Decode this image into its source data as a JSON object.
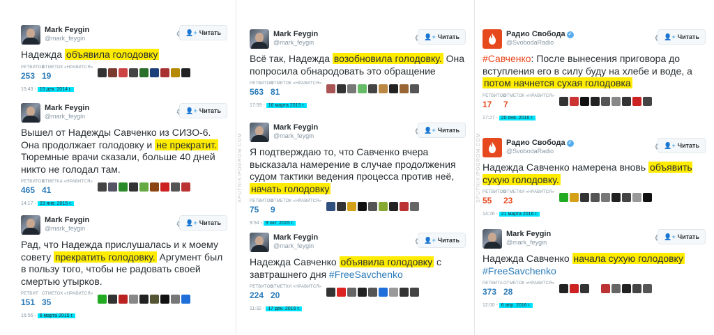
{
  "follow_label": "Читать",
  "watermark": "SPUTNIKIPOGROM.COM",
  "tweets": [
    {
      "name": "Mark Feygin",
      "handle": "@mark_feygin",
      "verified": false,
      "parts": [
        {
          "t": "Надежда "
        },
        {
          "t": "объявила голодовку",
          "h": true
        }
      ],
      "retweets_label": "РЕТВИТОВ",
      "likes_label": "ОТМЕТОК «НРАВИТСЯ»",
      "retweets": "253",
      "likes": "19",
      "time": "15:43 -",
      "date": "15 дек. 2014 г."
    },
    {
      "name": "Mark Feygin",
      "handle": "@mark_feygin",
      "verified": false,
      "parts": [
        {
          "t": "Вышел от Надежды Савченко из СИЗО-6. Она продолжает голодовку и "
        },
        {
          "t": "не прекратит.",
          "h": true
        },
        {
          "t": " Тюремные врачи сказали, больше 40 дней никто не голодал там."
        }
      ],
      "retweets_label": "РЕТВИТОВ",
      "likes_label": "ОТМЕТКА «НРАВИТСЯ»",
      "retweets": "465",
      "likes": "41",
      "time": "14:17 -",
      "date": "23 янв. 2015 г."
    },
    {
      "name": "Mark Feygin",
      "handle": "@mark_feygin",
      "verified": false,
      "parts": [
        {
          "t": "Рад, что Надежда прислушалась и к моему совету "
        },
        {
          "t": "прекратить голодовку.",
          "h": true
        },
        {
          "t": " Аргумент был в пользу того, чтобы не радовать своей смертью утырков."
        }
      ],
      "retweets_label": "РЕТВИТ",
      "likes_label": "ОТМЕТОК «НРАВИТСЯ»",
      "retweets": "151",
      "likes": "35",
      "time": "16:56 -",
      "date": "6 марта 2015 г."
    },
    {
      "name": "Mark Feygin",
      "handle": "@mark_feygin",
      "verified": false,
      "parts": [
        {
          "t": "Всё так, Надежда "
        },
        {
          "t": "возобновила голодовку.",
          "h": true
        },
        {
          "t": " Она попросила обнародовать это обращение"
        }
      ],
      "retweets_label": "РЕТВИТОВ",
      "likes_label": "ОТМЕТОК «НРАВИТСЯ»",
      "retweets": "563",
      "likes": "81",
      "time": "17:59 -",
      "date": "16 марта 2015 г."
    },
    {
      "name": "Mark Feygin",
      "handle": "@mark_feygin",
      "verified": false,
      "parts": [
        {
          "t": "Я подтверждаю то, что Савченко вчера высказала намерение в случае продолжения судом тактики ведения процесса против неё, "
        },
        {
          "t": "начать голодовку",
          "h": true
        }
      ],
      "retweets_label": "РЕТВИТОВ",
      "likes_label": "ОТМЕТОК «НРАВИТСЯ»",
      "retweets": "75",
      "likes": "9",
      "time": "9:54 -",
      "date": "9 окт. 2015 г."
    },
    {
      "name": "Mark Feygin",
      "handle": "@mark_feygin",
      "verified": false,
      "parts": [
        {
          "t": "Надежда Савченко "
        },
        {
          "t": "объявила голодовку",
          "h": true
        },
        {
          "t": " с завтрашнего дня "
        },
        {
          "t": "#FreeSavchenko",
          "tag": true
        }
      ],
      "retweets_label": "РЕТВИТОВ",
      "likes_label": "ОТМЕТКИ «НРАВИТСЯ»",
      "retweets": "224",
      "likes": "20",
      "time": "11:32 -",
      "date": "17 дек. 2015 г."
    },
    {
      "name": "Радио Свобода",
      "handle": "@SvobodaRadio",
      "verified": true,
      "parts": [
        {
          "t": "#Савченко",
          "tag": true
        },
        {
          "t": ": После вынесения приговора до вступления его в силу буду на хлебе и воде, а "
        },
        {
          "t": "потом начнется сухая голодовка",
          "h": true
        }
      ],
      "retweets_label": "РЕТВИТОВ",
      "likes_label": "ОТМЕТОК «НРАВИТСЯ»",
      "retweets": "17",
      "likes": "7",
      "time": "17:27 -",
      "date": "20 янв. 2016 г."
    },
    {
      "name": "Радио Свобода",
      "handle": "@SvobodaRadio",
      "verified": true,
      "parts": [
        {
          "t": "Надежда Савченко намерена вновь "
        },
        {
          "t": "объявить сухую голодовку.",
          "h": true
        }
      ],
      "retweets_label": "РЕТВИТОВ",
      "likes_label": "ОТМЕТКИ «НРАВИТСЯ»",
      "retweets": "55",
      "likes": "23",
      "time": "14:26 -",
      "date": "21 марта 2016 г."
    },
    {
      "name": "Mark Feygin",
      "handle": "@mark_feygin",
      "verified": false,
      "parts": [
        {
          "t": "Надежда Савченко "
        },
        {
          "t": "начала сухую голодовку",
          "h": true
        },
        {
          "t": " "
        },
        {
          "t": "#FreeSavchenko",
          "tag": true
        }
      ],
      "retweets_label": "РЕТВИТА",
      "likes_label": "ОТМЕТОК «НРАВИТСЯ»",
      "retweets": "373",
      "likes": "28",
      "time": "12:00 -",
      "date": "6 апр. 2016 г."
    }
  ]
}
